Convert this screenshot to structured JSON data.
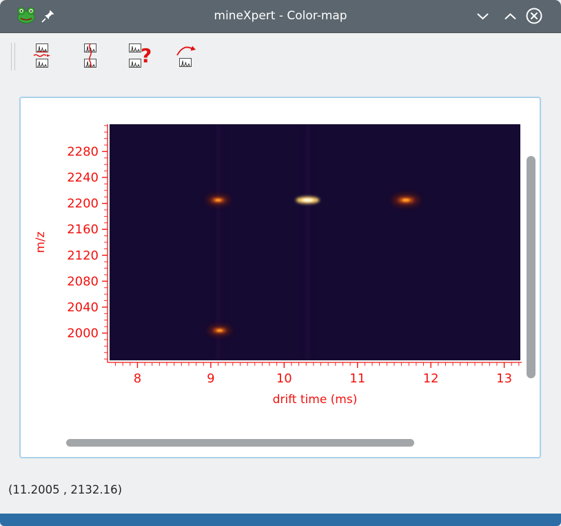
{
  "window": {
    "title": "mineXpert - Color-map",
    "titlebar_icons": {
      "app": "frog-icon",
      "pin": "pin-icon",
      "minimize": "chevron-down-icon",
      "maximize": "chevron-up-icon",
      "close": "close-circle-icon"
    }
  },
  "toolbar": {
    "buttons": [
      {
        "icon": "dual-spectra-horizontal-arrow-icon"
      },
      {
        "icon": "dual-spectra-vertical-line-icon"
      },
      {
        "icon": "dual-spectra-question-icon"
      },
      {
        "icon": "spectrum-rotate-arrow-icon"
      }
    ]
  },
  "statusbar": {
    "coordinates": "(11.2005 , 2132.16)"
  },
  "colors": {
    "titlebar": "#5b666e",
    "window_bg": "#eff0f1",
    "frame_border": "#a8d0ea",
    "bottom_bar": "#2d6da6",
    "scrollbar": "#a3a6a8",
    "axis_red": "#f1110d"
  },
  "chart_data": {
    "type": "heatmap",
    "title": "",
    "xlabel": "drift time (ms)",
    "ylabel": "m/z",
    "xlim": [
      7.62,
      13.22
    ],
    "ylim": [
      1958,
      2322
    ],
    "x_major_ticks": [
      8,
      9,
      10,
      11,
      12,
      13
    ],
    "x_minor_step": 0.1,
    "y_major_ticks": [
      2280,
      2240,
      2200,
      2160,
      2120,
      2080,
      2040,
      2000
    ],
    "y_minor_step": 10,
    "axis_color": "#f1110d",
    "background_color": "#150a31",
    "colormap": "inferno-like (dark purple background, orange-yellow maxima)",
    "features": [
      {
        "kind": "band",
        "x": 9.1
      },
      {
        "kind": "band",
        "x": 10.32
      },
      {
        "kind": "faint-line",
        "mz": 2205,
        "x_start": 7.62,
        "x_end": 13.22,
        "color": "#5c1630",
        "width": 2,
        "opacity": 0.8
      },
      {
        "kind": "faint-line",
        "mz": 2146,
        "x_start": 8.9,
        "x_end": 11.8
      },
      {
        "kind": "faint-line",
        "mz": 2090,
        "x_start": 8.6,
        "x_end": 11.4,
        "opacity": 0.55
      },
      {
        "kind": "faint-line",
        "mz": 2004,
        "x_start": 9.0,
        "x_end": 10.7,
        "color": "#3f1038",
        "opacity": 0.8
      },
      {
        "kind": "streak",
        "mz": 2205,
        "x_start": 9.3,
        "x_end": 11.78,
        "peak_x": 10.32,
        "intensity": "strong"
      },
      {
        "kind": "spot",
        "mz": 2205,
        "x": 9.1,
        "intensity": "medium"
      },
      {
        "kind": "spot",
        "mz": 2205,
        "x": 11.66,
        "intensity": "medium-high"
      },
      {
        "kind": "spot",
        "mz": 2004,
        "x": 9.12,
        "intensity": "medium"
      }
    ]
  }
}
